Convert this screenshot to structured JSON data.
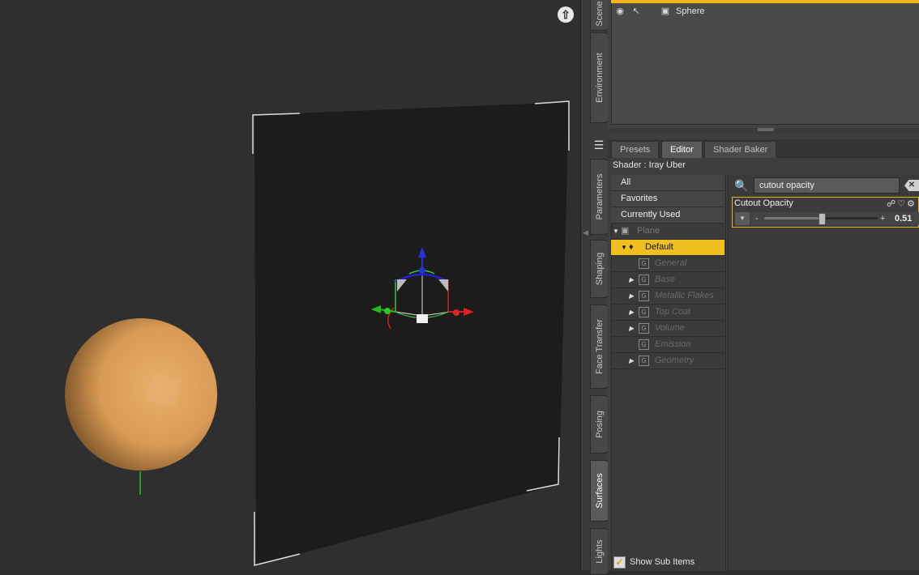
{
  "viewport": {
    "nav_up_icon": "up-arrow-icon",
    "sphere_color": "#e0a560",
    "plane_color": "#1c1c1c"
  },
  "side_tabs": [
    {
      "label": "Scene"
    },
    {
      "label": "Environment"
    },
    {
      "label": "Parameters"
    },
    {
      "label": "Shaping"
    },
    {
      "label": "Face Transfer"
    },
    {
      "label": "Posing"
    },
    {
      "label": "Surfaces",
      "active": true
    },
    {
      "label": "Lights"
    }
  ],
  "scene": {
    "items": [
      {
        "label": "Sphere"
      }
    ],
    "selection_color": "#f0b61c"
  },
  "surfaces": {
    "tabs": [
      {
        "label": "Presets"
      },
      {
        "label": "Editor",
        "active": true
      },
      {
        "label": "Shader Baker"
      }
    ],
    "shader_label": "Shader : Iray Uber",
    "categories": [
      {
        "label": "All"
      },
      {
        "label": "Favorites"
      },
      {
        "label": "Currently Used"
      }
    ],
    "tree": {
      "root": "Plane",
      "selected": "Default",
      "groups": [
        {
          "label": "General",
          "expandable": false
        },
        {
          "label": "Base",
          "expandable": true
        },
        {
          "label": "Metallic Flakes",
          "expandable": true
        },
        {
          "label": "Top Coat",
          "expandable": true
        },
        {
          "label": "Volume",
          "expandable": true
        },
        {
          "label": "Emission",
          "expandable": false
        },
        {
          "label": "Geometry",
          "expandable": true
        }
      ]
    },
    "filter": {
      "value": "cutout opacity",
      "clear_icon": "clear-icon"
    },
    "property": {
      "name": "Cutout Opacity",
      "value": "0.51",
      "fraction": 0.51,
      "minus": "-",
      "plus": "+"
    },
    "show_sub_items": {
      "label": "Show Sub Items",
      "checked": true
    }
  }
}
